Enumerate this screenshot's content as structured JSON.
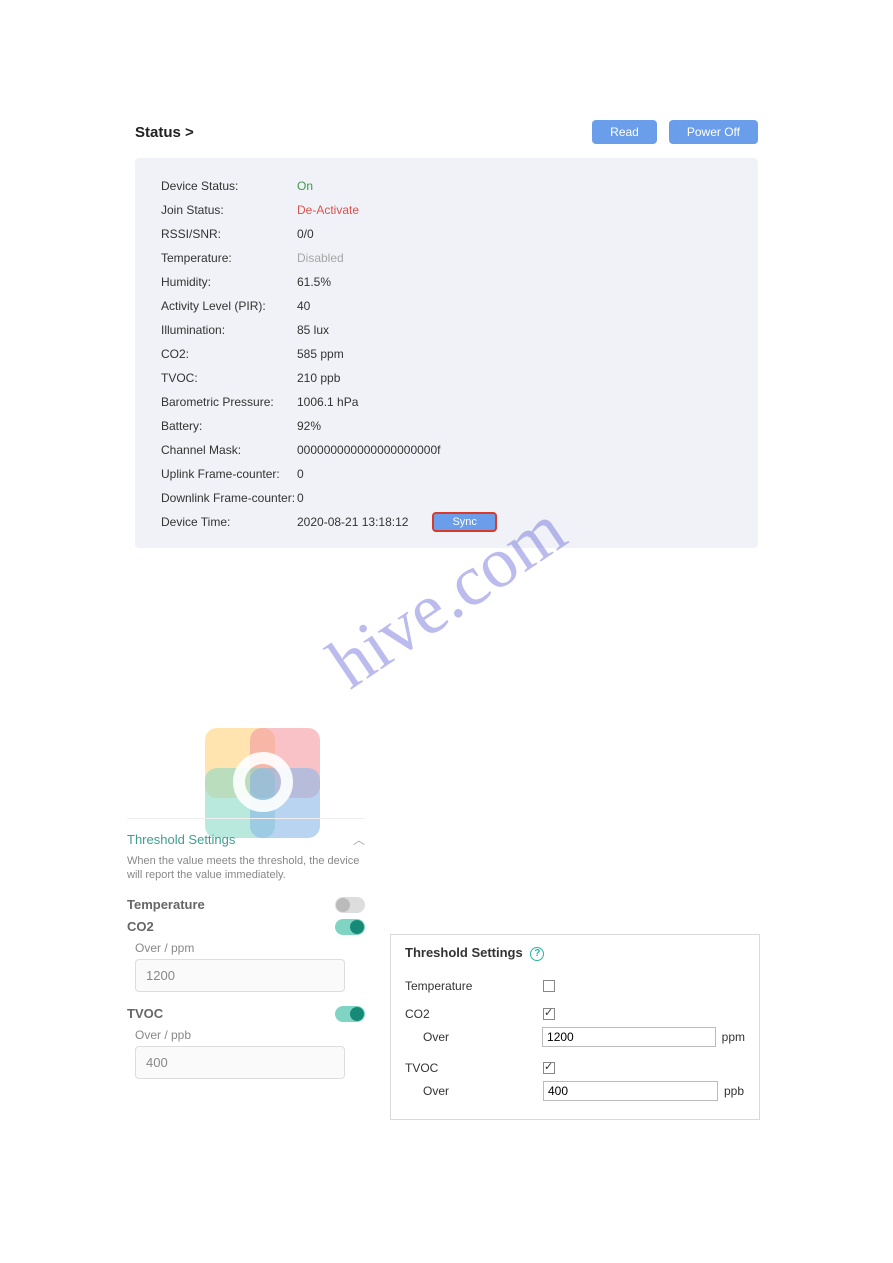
{
  "header": {
    "title": "Status >",
    "read_btn": "Read",
    "poweroff_btn": "Power Off"
  },
  "status": {
    "rows": [
      {
        "label": "Device Status:",
        "value": "On",
        "cls": "val-green"
      },
      {
        "label": "Join Status:",
        "value": "De-Activate",
        "cls": "val-red"
      },
      {
        "label": "RSSI/SNR:",
        "value": "0/0",
        "cls": ""
      },
      {
        "label": "Temperature:",
        "value": "Disabled",
        "cls": "val-grey"
      },
      {
        "label": "Humidity:",
        "value": "61.5%",
        "cls": ""
      },
      {
        "label": "Activity Level (PIR):",
        "value": "40",
        "cls": ""
      },
      {
        "label": "Illumination:",
        "value": "85 lux",
        "cls": ""
      },
      {
        "label": "CO2:",
        "value": "585 ppm",
        "cls": ""
      },
      {
        "label": "TVOC:",
        "value": "210 ppb",
        "cls": ""
      },
      {
        "label": "Barometric Pressure:",
        "value": "1006.1 hPa",
        "cls": ""
      },
      {
        "label": "Battery:",
        "value": "92%",
        "cls": ""
      },
      {
        "label": "Channel Mask:",
        "value": "000000000000000000000f",
        "cls": ""
      },
      {
        "label": "Uplink Frame-counter:",
        "value": "0",
        "cls": ""
      },
      {
        "label": "Downlink Frame-counter:",
        "value": "0",
        "cls": ""
      }
    ],
    "device_time_label": "Device Time:",
    "device_time_value": "2020-08-21 13:18:12",
    "sync_btn": "Sync"
  },
  "mobile": {
    "title": "Threshold Settings",
    "subtitle": "When the value meets the threshold, the device will report the value immediately.",
    "temperature_label": "Temperature",
    "co2_label": "CO2",
    "co2_over_label": "Over / ppm",
    "co2_over_value": "1200",
    "tvoc_label": "TVOC",
    "tvoc_over_label": "Over / ppb",
    "tvoc_over_value": "400"
  },
  "desk": {
    "title": "Threshold Settings",
    "temperature_label": "Temperature",
    "co2_label": "CO2",
    "over_label": "Over",
    "co2_over_value": "1200",
    "co2_unit": "ppm",
    "tvoc_label": "TVOC",
    "tvoc_over_value": "400",
    "tvoc_unit": "ppb"
  },
  "watermark": "hive.com"
}
